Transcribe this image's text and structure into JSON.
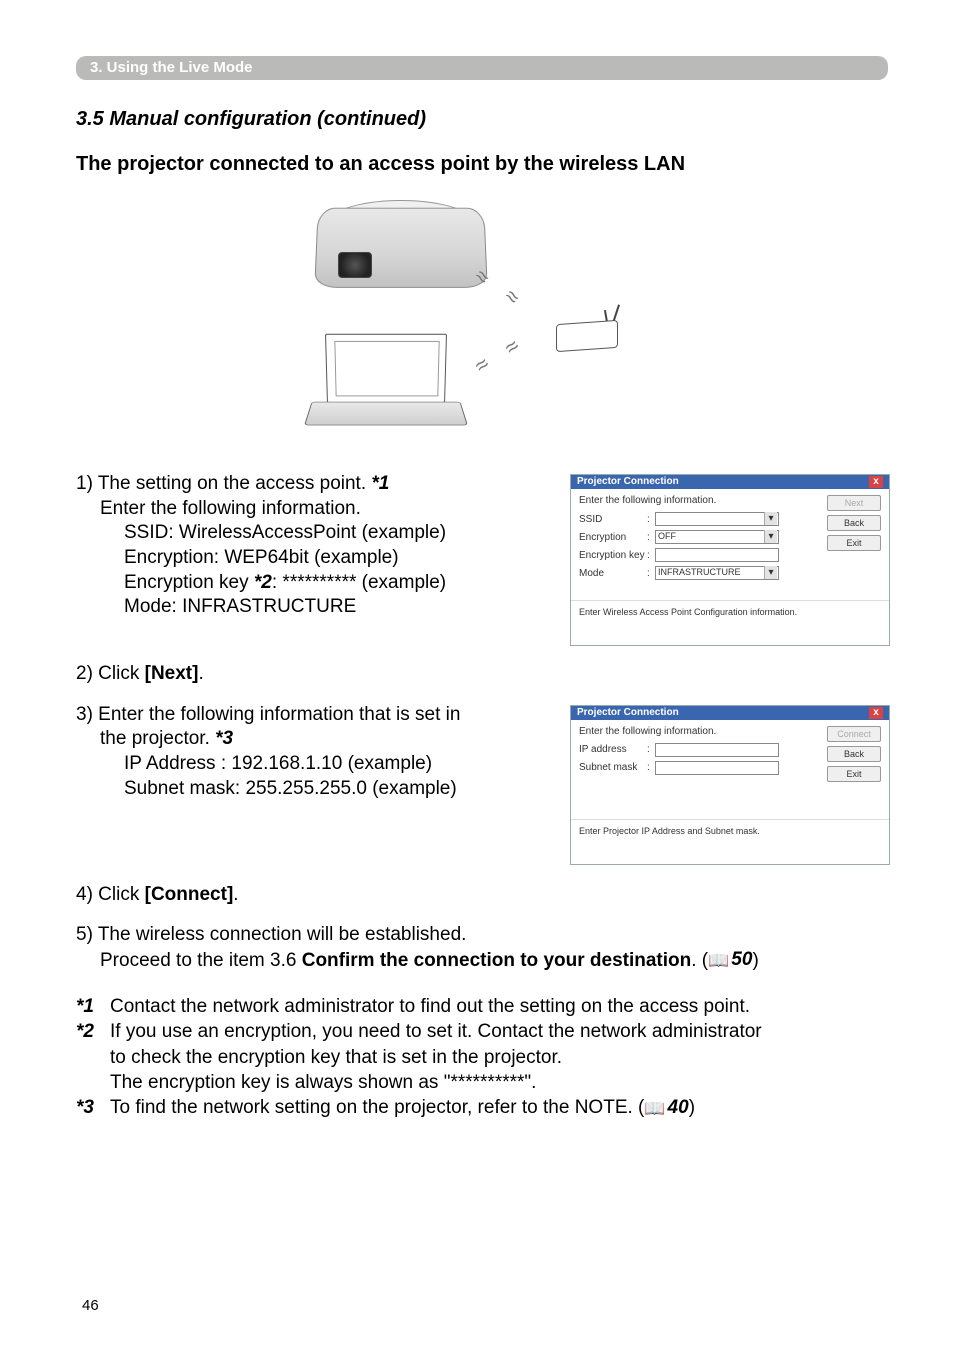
{
  "header": {
    "chapter": "3. Using the Live Mode"
  },
  "section": {
    "title": "3.5 Manual configuration (continued)",
    "subtitle": "The projector connected to an access point by the wireless LAN"
  },
  "steps": {
    "s1_intro": "1) The setting on the access point. ",
    "s1_fn": "*1",
    "s1_line2": "Enter the following information.",
    "s1_ssid": "SSID: WirelessAccessPoint (example)",
    "s1_enc": "Encryption: WEP64bit (example)",
    "s1_key_pre": "Encryption key ",
    "s1_key_fn": "*2",
    "s1_key_post": ": ********** (example)",
    "s1_mode": "Mode: INFRASTRUCTURE",
    "s2_pre": "2) Click ",
    "s2_bold": "[Next]",
    "s2_post": ".",
    "s3_line1a": "3) Enter the following information that is set in",
    "s3_line1b_pre": "the projector. ",
    "s3_fn": "*3",
    "s3_ip": "IP Address : 192.168.1.10 (example)",
    "s3_mask": "Subnet mask: 255.255.255.0 (example)",
    "s4_pre": "4) Click ",
    "s4_bold": "[Connect]",
    "s4_post": ".",
    "s5_line1": "5) The wireless connection will be established.",
    "s5_line2_pre": "Proceed to the item 3.6 ",
    "s5_line2_bold": "Confirm the connection to your destination",
    "s5_line2_post": ". (",
    "s5_ref": "50",
    "s5_close": ")"
  },
  "dialog1": {
    "title": "Projector Connection",
    "instr": "Enter the following information.",
    "labels": {
      "ssid": "SSID",
      "enc": "Encryption",
      "key": "Encryption key",
      "mode": "Mode"
    },
    "enc_value": "OFF",
    "mode_value": "INFRASTRUCTURE",
    "status": "Enter Wireless Access Point Configuration information.",
    "buttons": {
      "next": "Next",
      "back": "Back",
      "exit": "Exit"
    }
  },
  "dialog2": {
    "title": "Projector Connection",
    "instr": "Enter the following information.",
    "labels": {
      "ip": "IP address",
      "mask": "Subnet mask"
    },
    "status": "Enter Projector IP Address and Subnet mask.",
    "buttons": {
      "connect": "Connect",
      "back": "Back",
      "exit": "Exit"
    }
  },
  "footnotes": {
    "f1_label": "*1",
    "f1_text": "Contact the network administrator to find out the setting on the access point.",
    "f2_label": "*2",
    "f2_text_l1": "If you use an encryption, you need to set it. Contact the network administrator",
    "f2_text_l2": "to check the encryption key that is set in the projector.",
    "f2_text_l3": "The encryption key is always shown as \"**********\".",
    "f3_label": "*3",
    "f3_text_pre": "To find the network setting on the projector, refer to the NOTE. (",
    "f3_ref": "40",
    "f3_close": ")"
  },
  "page_number": "46"
}
